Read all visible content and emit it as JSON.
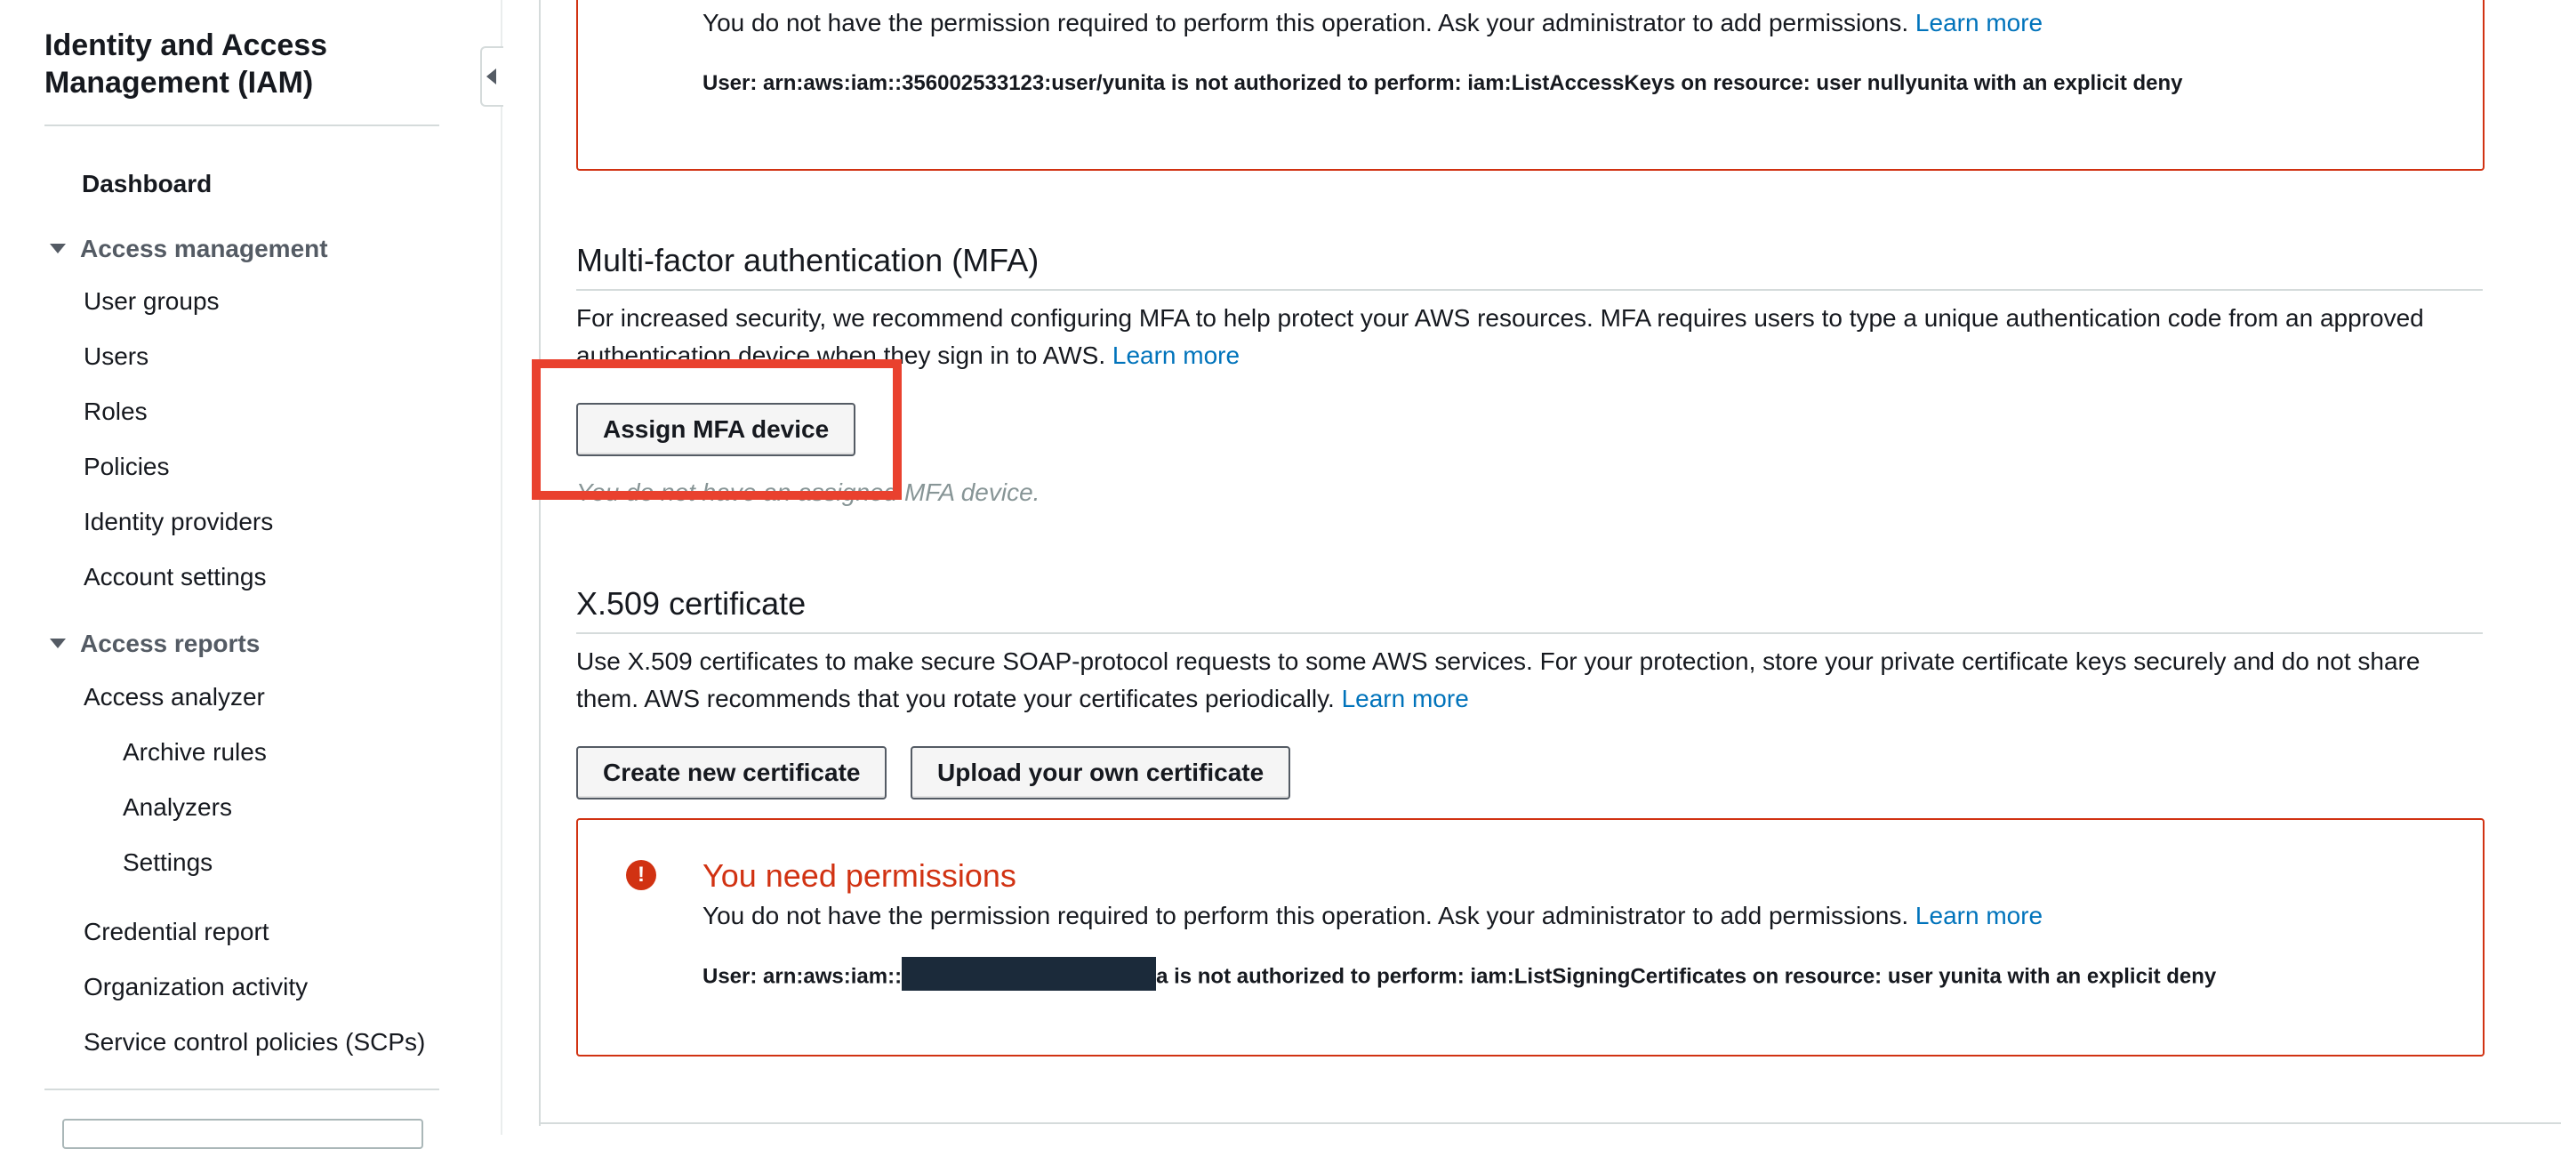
{
  "sidebar": {
    "title": "Identity and Access Management (IAM)",
    "dashboard": "Dashboard",
    "access_management": {
      "label": "Access management",
      "items": [
        "User groups",
        "Users",
        "Roles",
        "Policies",
        "Identity providers",
        "Account settings"
      ]
    },
    "access_reports": {
      "label": "Access reports",
      "access_analyzer": "Access analyzer",
      "sub_items": [
        "Archive rules",
        "Analyzers",
        "Settings"
      ],
      "items": [
        "Credential report",
        "Organization activity",
        "Service control policies (SCPs)"
      ]
    }
  },
  "top_error": {
    "message": "You do not have the permission required to perform this operation. Ask your administrator to add permissions.",
    "learn_more": "Learn more",
    "detail": "User: arn:aws:iam::356002533123:user/yunita is not authorized to perform: iam:ListAccessKeys on resource: user nullyunita with an explicit deny"
  },
  "mfa": {
    "title": "Multi-factor authentication (MFA)",
    "description": "For increased security, we recommend configuring MFA to help protect your AWS resources. MFA requires users to type a unique authentication code from an approved authentication device when they sign in to AWS.",
    "learn_more": "Learn more",
    "assign_button": "Assign MFA device",
    "no_device": "You do not have an assigned MFA device."
  },
  "x509": {
    "title": "X.509 certificate",
    "description": "Use X.509 certificates to make secure SOAP-protocol requests to some AWS services. For your protection, store your private certificate keys securely and do not share them. AWS recommends that you rotate your certificates periodically.",
    "learn_more": "Learn more",
    "create_button": "Create new certificate",
    "upload_button": "Upload your own certificate"
  },
  "bottom_error": {
    "title": "You need permissions",
    "icon": "alert-icon",
    "message": "You do not have the permission required to perform this operation. Ask your administrator to add permissions.",
    "learn_more": "Learn more",
    "detail_prefix": "User: arn:aws:iam::",
    "detail_suffix": "a is not authorized to perform: iam:ListSigningCertificates on resource: user yunita with an explicit deny"
  },
  "colors": {
    "error": "#d13212",
    "link": "#0073bb",
    "highlight": "#e9412e",
    "redaction": "#1b2a3a"
  }
}
